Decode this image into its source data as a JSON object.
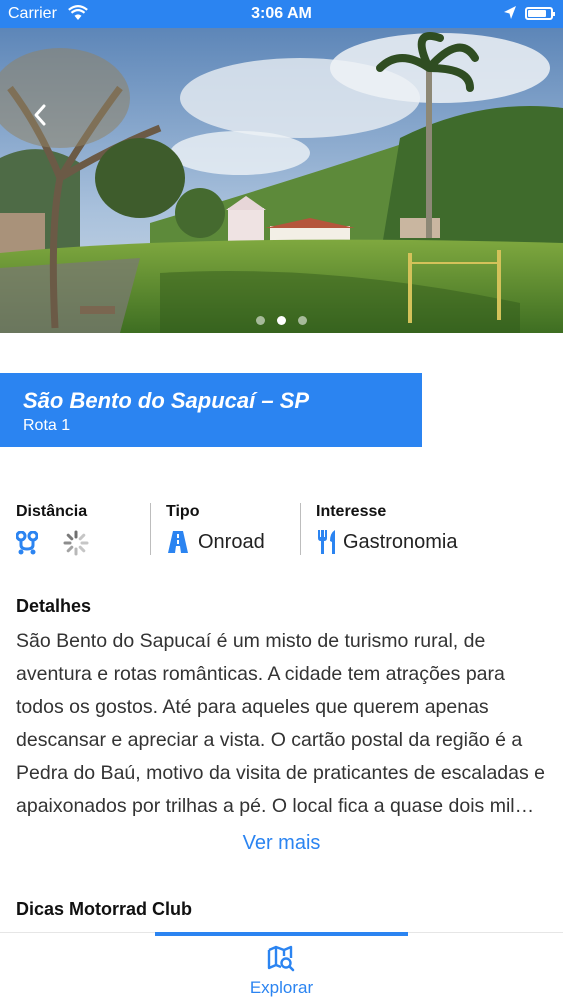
{
  "status_bar": {
    "carrier": "Carrier",
    "time": "3:06 AM"
  },
  "hero": {
    "page_count": 3,
    "active_page": 2
  },
  "title_card": {
    "title": "São Bento do Sapucaí – SP",
    "subtitle": "Rota 1"
  },
  "attributes": {
    "distance": {
      "label": "Distância",
      "icon": "route-icon",
      "value_state": "loading"
    },
    "type": {
      "label": "Tipo",
      "icon": "road-icon",
      "value": "Onroad"
    },
    "interest": {
      "label": "Interesse",
      "icon": "fork-knife-icon",
      "value": "Gastronomia"
    }
  },
  "details": {
    "heading": "Detalhes",
    "lines": [
      "São Bento do Sapucaí é um misto de turismo rural, de",
      "aventura e rotas românticas. A cidade tem atrações para",
      "todos os gostos. Até para aqueles que querem apenas",
      "descansar e apreciar a vista. O cartão postal da região é a",
      "Pedra do Baú, motivo da visita de praticantes de escaladas e",
      "apaixonados por trilhas a pé. O local fica a quase dois mil…"
    ],
    "see_more": "Ver mais"
  },
  "tips": {
    "heading": "Dicas Motorrad Club"
  },
  "tab_bar": {
    "tabs": [
      {
        "label": "Explorar",
        "icon": "map-search-icon",
        "active": true
      }
    ]
  },
  "colors": {
    "accent": "#2b84f1"
  }
}
